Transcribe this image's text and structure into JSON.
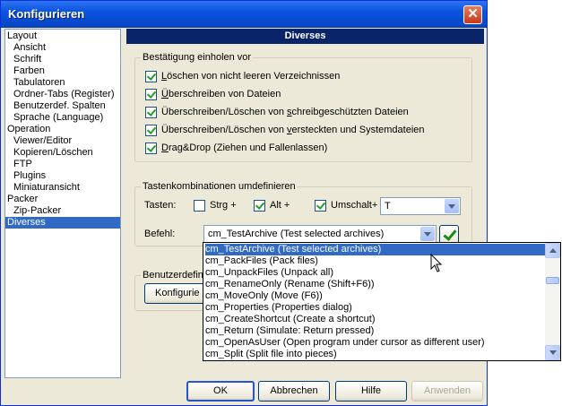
{
  "window": {
    "title": "Konfigurieren"
  },
  "tree": {
    "items": [
      {
        "label": "Layout",
        "level": 0
      },
      {
        "label": "Ansicht",
        "level": 1
      },
      {
        "label": "Schrift",
        "level": 1
      },
      {
        "label": "Farben",
        "level": 1
      },
      {
        "label": "Tabulatoren",
        "level": 1
      },
      {
        "label": "Ordner-Tabs (Register)",
        "level": 1
      },
      {
        "label": "Benutzerdef. Spalten",
        "level": 1
      },
      {
        "label": "Sprache (Language)",
        "level": 1
      },
      {
        "label": "Operation",
        "level": 0
      },
      {
        "label": "Viewer/Editor",
        "level": 1
      },
      {
        "label": "Kopieren/Löschen",
        "level": 1
      },
      {
        "label": "FTP",
        "level": 1
      },
      {
        "label": "Plugins",
        "level": 1
      },
      {
        "label": "Miniaturansicht",
        "level": 1
      },
      {
        "label": "Packer",
        "level": 0
      },
      {
        "label": "Zip-Packer",
        "level": 1
      },
      {
        "label": "Diverses",
        "level": 0,
        "selected": true
      }
    ]
  },
  "panel": {
    "title": "Diverses",
    "confirm_group": {
      "title": "Bestätigung einholen vor",
      "items": [
        {
          "pre": "",
          "u": "L",
          "post": "öschen von nicht leeren Verzeichnissen",
          "checked": true
        },
        {
          "pre": "",
          "u": "Ü",
          "post": "berschreiben von Dateien",
          "checked": true
        },
        {
          "pre": "Überschreiben/Löschen von ",
          "u": "s",
          "post": "chreibgeschützten Dateien",
          "checked": true
        },
        {
          "pre": "Überschreiben/Löschen von ",
          "u": "v",
          "post": "ersteckten und Systemdateien",
          "checked": true
        },
        {
          "pre": "",
          "u": "D",
          "post": "rag&Drop (Ziehen und Fallenlassen)",
          "checked": true
        }
      ]
    },
    "keys_group": {
      "title": "Tastenkombinationen umdefinieren",
      "tasten_label": "Tasten:",
      "strg": {
        "label": "Strg +",
        "checked": false
      },
      "alt": {
        "label": "Alt +",
        "checked": true
      },
      "shift": {
        "label": "Umschalt+",
        "checked": true
      },
      "key_value": "T",
      "befehl_label": "Befehl:",
      "befehl_value": "cm_TestArchive (Test selected archives)"
    },
    "user_group": {
      "title_visible": "Benutzerdefini",
      "button_label": "Konfigurie"
    }
  },
  "dropdown": {
    "items": [
      "cm_TestArchive (Test selected archives)",
      "cm_PackFiles (Pack files)",
      "cm_UnpackFiles (Unpack all)",
      "cm_RenameOnly (Rename (Shift+F6))",
      "cm_MoveOnly (Move (F6))",
      "cm_Properties (Properties dialog)",
      "cm_CreateShortcut (Create a shortcut)",
      "cm_Return (Simulate: Return pressed)",
      "cm_OpenAsUser (Open program under cursor as different user)",
      "cm_Split (Split file into pieces)"
    ],
    "selected_index": 0
  },
  "buttons": {
    "ok": "OK",
    "cancel": "Abbrechen",
    "help": "Hilfe",
    "apply": "Anwenden"
  }
}
